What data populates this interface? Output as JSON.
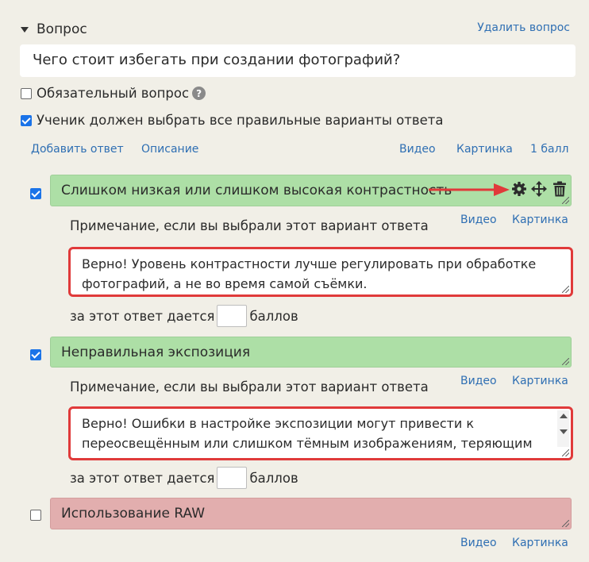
{
  "header": {
    "title": "Вопрос",
    "delete_label": "Удалить вопрос"
  },
  "question": {
    "text": "Чего стоит избегать при создании фотографий?"
  },
  "options": {
    "required_label": "Обязательный вопрос",
    "required_checked": false,
    "all_correct_label": "Ученик должен выбрать все правильные варианты ответа",
    "all_correct_checked": true
  },
  "toolbar": {
    "add_answer": "Добавить ответ",
    "description": "Описание",
    "video": "Видео",
    "picture": "Картинка",
    "points": "1 балл"
  },
  "answers": [
    {
      "text": "Слишком низкая или слишком высокая контрастность",
      "checked": true,
      "status_color": "#addfa6",
      "note_label": "Примечание, если вы выбрали этот вариант ответа",
      "note_text": "Верно! Уровень контрастности лучше регулировать при обработке фотографий, а не во время самой съёмки.",
      "video": "Видео",
      "picture": "Картинка",
      "points_before": "за этот ответ дается",
      "points_value": "",
      "points_after": "баллов"
    },
    {
      "text": "Неправильная экспозиция",
      "checked": true,
      "status_color": "#addfa6",
      "note_label": "Примечание, если вы выбрали этот вариант ответа",
      "note_text": "Верно! Ошибки в настройке экспозиции могут привести к переосвещённым или слишком тёмным изображениям, теряющим",
      "video": "Видео",
      "picture": "Картинка",
      "points_before": "за этот ответ дается",
      "points_value": "",
      "points_after": "баллов"
    },
    {
      "text": "Использование RAW",
      "checked": false,
      "status_color": "#e2aeae",
      "video": "Видео",
      "picture": "Картинка"
    }
  ],
  "icons": {
    "answer_tools": [
      "gear-icon",
      "move-icon",
      "trash-icon"
    ],
    "annotation": "red-arrow-icon",
    "help": "?"
  },
  "colors": {
    "link": "#2f6fb3",
    "checkbox": "#1a73e8",
    "highlight": "#e03a3a"
  }
}
